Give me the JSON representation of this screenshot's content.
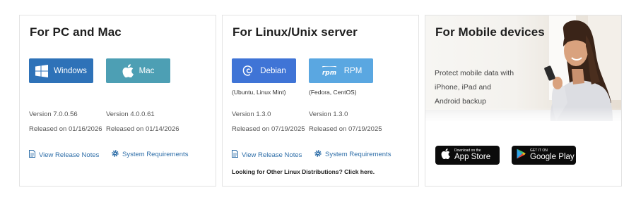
{
  "pc": {
    "title": "For PC and Mac",
    "windows_label": "Windows",
    "mac_label": "Mac",
    "windows_version": "Version 7.0.0.56",
    "windows_released": "Released on 01/16/2026",
    "mac_version": "Version 4.0.0.61",
    "mac_released": "Released on 01/14/2026",
    "release_notes": "View Release Notes",
    "system_req": "System Requirements"
  },
  "linux": {
    "title": "For Linux/Unix server",
    "debian_label": "Debian",
    "rpm_label": "RPM",
    "debian_note": "(Ubuntu, Linux Mint)",
    "rpm_note": "(Fedora, CentOS)",
    "debian_version": "Version 1.3.0",
    "debian_released": "Released on 07/19/2025",
    "rpm_version": "Version 1.3.0",
    "rpm_released": "Released on 07/19/2025",
    "release_notes": "View Release Notes",
    "system_req": "System Requirements",
    "other_link": "Looking for Other Linux Distributions? Click here."
  },
  "mobile": {
    "title": "For Mobile devices",
    "desc_line1": "Protect mobile data with",
    "desc_line2": "iPhone, iPad and",
    "desc_line3": "Android backup",
    "appstore_small": "Download on the",
    "appstore_big": "App Store",
    "googleplay_small": "GET IT ON",
    "googleplay_big": "Google Play"
  },
  "colors": {
    "windows": "#2e72b8",
    "mac": "#4d9fb4",
    "debian": "#3f74d6",
    "rpm": "#5aa7e1",
    "link": "#2e6ea8"
  },
  "icons": {
    "windows": "windows-logo-icon",
    "mac": "apple-logo-icon",
    "debian": "debian-swirl-icon",
    "rpm": "rpm-logo-icon",
    "release_notes": "document-icon",
    "system_req": "gear-icon",
    "appstore": "apple-logo-icon",
    "googleplay": "play-triangle-icon"
  }
}
